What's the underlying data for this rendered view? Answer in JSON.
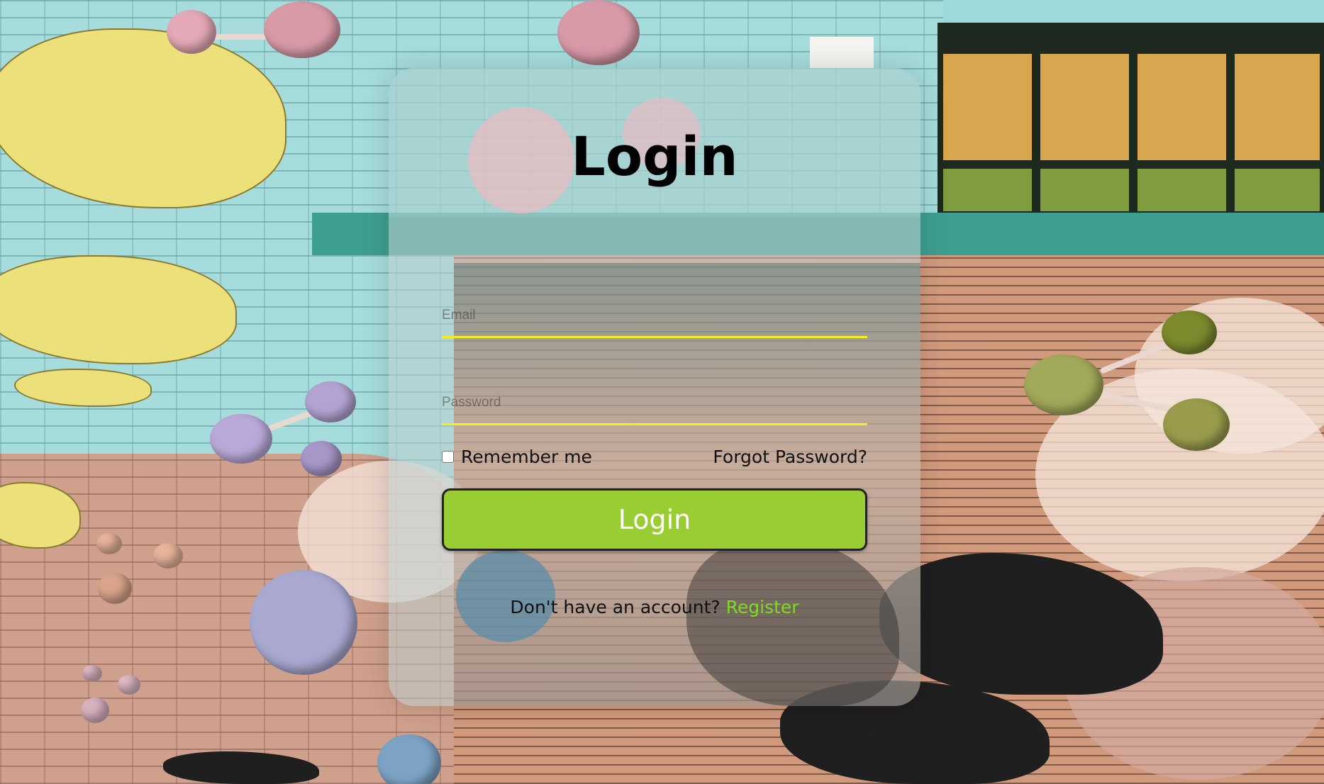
{
  "login_form": {
    "title": "Login",
    "email_placeholder": "Email",
    "password_placeholder": "Password",
    "remember_label": "Remember me",
    "forgot_label": "Forgot Password?",
    "submit_label": "Login",
    "register_prompt": "Don't have an account?",
    "register_label": "Register"
  },
  "colors": {
    "accent_button": "#9acd32",
    "input_underline": "#f5ef1f",
    "register_link": "#7ddc1f"
  }
}
